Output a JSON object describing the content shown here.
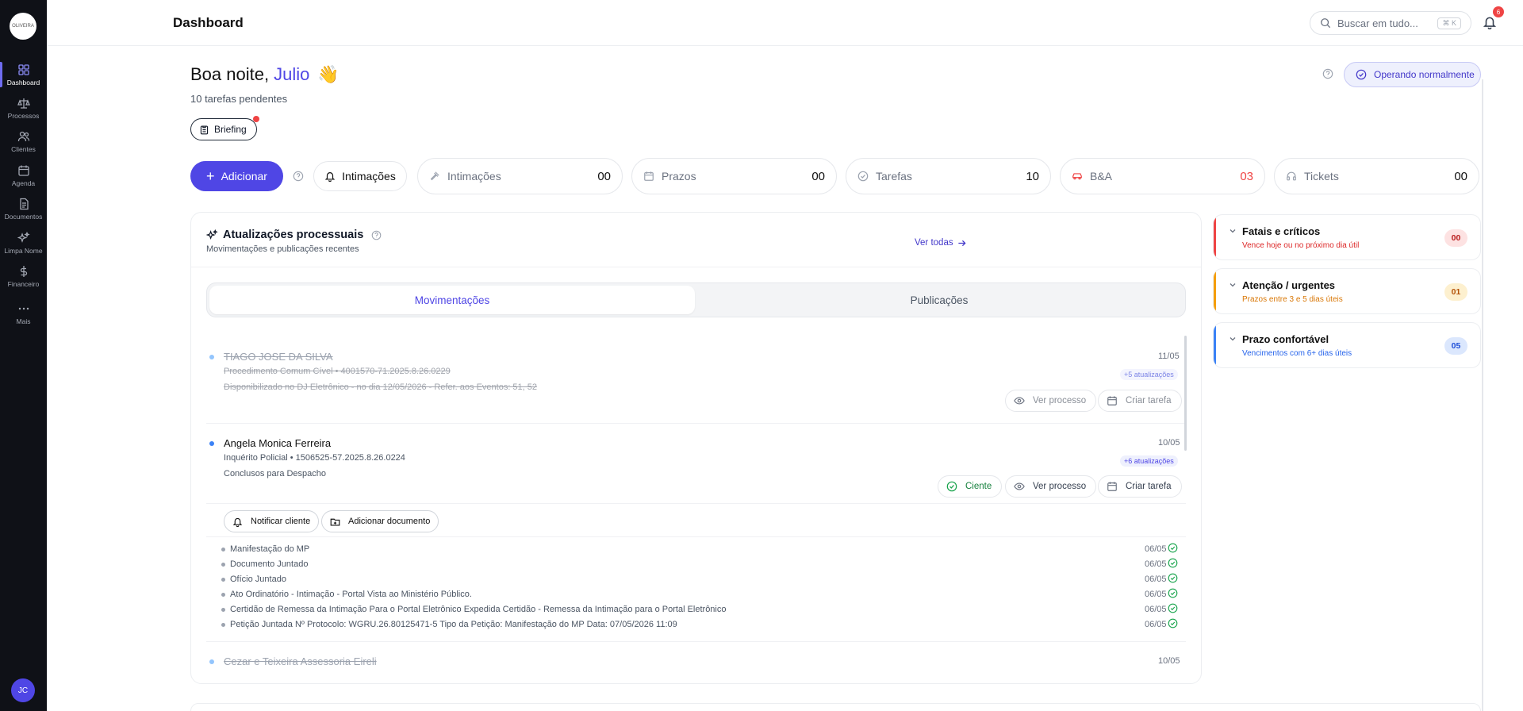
{
  "sidebar": {
    "logo_text": "OLIVEIRA",
    "items": [
      {
        "label": "Dashboard"
      },
      {
        "label": "Processos"
      },
      {
        "label": "Clientes"
      },
      {
        "label": "Agenda"
      },
      {
        "label": "Documentos"
      },
      {
        "label": "Limpa Nome"
      },
      {
        "label": "Financeiro"
      },
      {
        "label": "Mais"
      }
    ],
    "avatar_initials": "JC"
  },
  "header": {
    "title": "Dashboard",
    "search_placeholder": "Buscar em tudo...",
    "search_shortcut": "⌘ K",
    "notification_count": "6"
  },
  "greeting": {
    "prefix": "Boa noite,",
    "name": "Julio",
    "emoji": "👋",
    "pending": "10 tarefas pendentes",
    "briefing_label": "Briefing",
    "status_label": "Operando normalmente"
  },
  "actions": {
    "add_label": "Adicionar",
    "intimacoes_label": "Intimações"
  },
  "stats": [
    {
      "label": "Intimações",
      "value": "00",
      "icon": "gavel-icon"
    },
    {
      "label": "Prazos",
      "value": "00",
      "icon": "calendar-icon"
    },
    {
      "label": "Tarefas",
      "value": "10",
      "icon": "check-circle-icon"
    },
    {
      "label": "B&A",
      "value": "03",
      "icon": "car-icon"
    },
    {
      "label": "Tickets",
      "value": "00",
      "icon": "headset-icon"
    }
  ],
  "updates": {
    "title": "Atualizações processuais",
    "subtitle": "Movimentações e publicações recentes",
    "see_all": "Ver todas",
    "tabs": [
      "Movimentações",
      "Publicações"
    ],
    "items": [
      {
        "name": "TIAGO JOSE DA SILVA",
        "line1": "Procedimento Comum Cível • 4001570-71.2025.8.26.0229",
        "line2": "Disponibilizado no DJ Eletrônico - no dia 12/05/2026 - Refer. aos Eventos: 51, 52",
        "date": "11/05",
        "updates": "+5 atualizações",
        "view": "Ver processo",
        "task": "Criar tarefa"
      },
      {
        "name": "Angela Monica Ferreira",
        "line1": "Inquérito Policial • 1506525-57.2025.8.26.0224",
        "line2": "Conclusos para Despacho",
        "date": "10/05",
        "updates": "+6 atualizações",
        "aware": "Ciente",
        "view": "Ver processo",
        "task": "Criar tarefa"
      },
      {
        "name": "Cezar e Teixeira Assessoria Eireli",
        "date": "10/05"
      }
    ],
    "notify_label": "Notificar cliente",
    "add_doc_label": "Adicionar documento",
    "sub_items": [
      {
        "text": "Manifestação do MP",
        "date": "06/05"
      },
      {
        "text": "Documento Juntado",
        "date": "06/05"
      },
      {
        "text": "Ofício Juntado",
        "date": "06/05"
      },
      {
        "text": "Ato Ordinatório - Intimação - Portal Vista ao Ministério Público.",
        "date": "06/05"
      },
      {
        "text": "Certidão de Remessa da Intimação Para o Portal Eletrônico Expedida Certidão - Remessa da Intimação para o Portal Eletrônico",
        "date": "06/05"
      },
      {
        "text": "Petição Juntada Nº Protocolo: WGRU.26.80125471-5 Tipo da Petição: Manifestação do MP Data: 07/05/2026 11:09",
        "date": "06/05"
      }
    ]
  },
  "deadlines": [
    {
      "title": "Fatais e críticos",
      "subtitle": "Vence hoje ou no próximo dia útil",
      "count": "00",
      "color": "#ef4444",
      "sub_color": "#dc2626",
      "badge_bg": "#fde2e2",
      "badge_fg": "#b91c1c"
    },
    {
      "title": "Atenção / urgentes",
      "subtitle": "Prazos entre 3 e 5 dias úteis",
      "count": "01",
      "color": "#f59e0b",
      "sub_color": "#d97706",
      "badge_bg": "#fdf0cf",
      "badge_fg": "#b45309"
    },
    {
      "title": "Prazo confortável",
      "subtitle": "Vencimentos com 6+ dias úteis",
      "count": "05",
      "color": "#3b82f6",
      "sub_color": "#2563eb",
      "badge_bg": "#dbe7fd",
      "badge_fg": "#1d4ed8"
    }
  ],
  "colors": {
    "accent": "#4f46e5",
    "sidebar_bg": "#0f1117"
  }
}
